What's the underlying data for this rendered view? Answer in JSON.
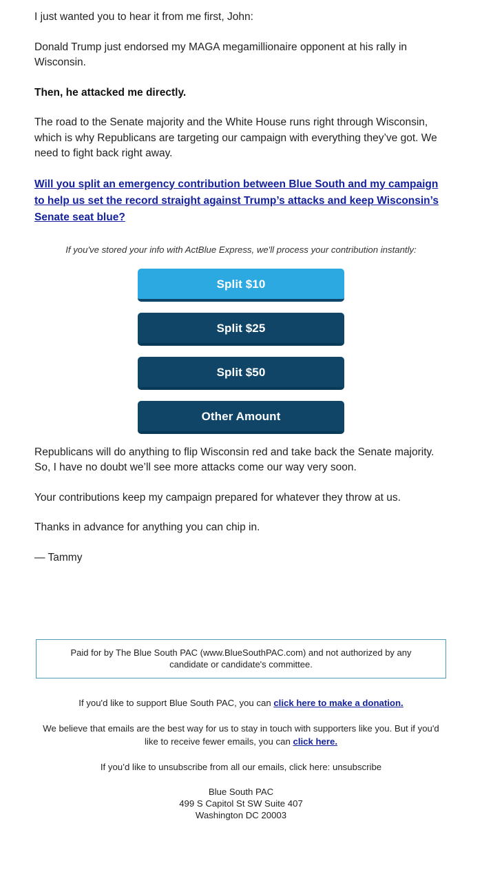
{
  "email": {
    "greeting": "I just wanted you to hear it from me first, John:",
    "paragraph_trump": "Donald Trump just endorsed my MAGA megamillionaire opponent at his rally in Wisconsin.",
    "bold_attack_line": "Then, he attacked me directly.",
    "paragraph_road": "The road to the Senate majority and the White House runs right through Wisconsin, which is why Republicans are targeting our campaign with everything they’ve got. We need to fight back right away.",
    "ask_link": "Will you split an emergency contribution between Blue South and my campaign to help us set the record straight against Trump’s attacks and keep Wisconsin’s Senate seat blue?",
    "express_note": "If you've stored your info with ActBlue Express, we'll process your contribution instantly:",
    "paragraph_republicans": "Republicans will do anything to flip Wisconsin red and take back the Senate majority. So, I have no doubt we’ll see more attacks come our way very soon.",
    "paragraph_contributions": "Your contributions keep my campaign prepared for whatever they throw at us.",
    "paragraph_thanks": "Thanks in advance for anything you can chip in.",
    "signature": "— Tammy"
  },
  "donation_buttons": [
    {
      "label": "Split $10",
      "style": "light"
    },
    {
      "label": "Split $25",
      "style": "dark"
    },
    {
      "label": "Split $50",
      "style": "dark"
    },
    {
      "label": "Other Amount",
      "style": "dark"
    }
  ],
  "disclaimer": {
    "line1": "Paid for by The Blue South PAC (www.BlueSouthPAC.com) and not authorized by any",
    "line2": "candidate or candidate's committee."
  },
  "footer": {
    "support_text_before": "If you'd like to support Blue South PAC, you can ",
    "support_link": "click here to make a donation.",
    "fewer_emails_before": "We believe that emails are the best way for us to stay in touch with supporters like you. But if you'd like to receive fewer emails, you can ",
    "fewer_emails_link": "click here.",
    "unsubscribe_text": "If you’d like to unsubscribe from all our emails, click here: unsubscribe",
    "org_name": "Blue South PAC",
    "address_street": "499 S Capitol St SW Suite 407",
    "address_city": "Washington DC 20003"
  },
  "colors": {
    "link_blue": "#15229b",
    "button_light_blue": "#2ca9e0",
    "button_dark_navy": "#104568",
    "disclaimer_border": "#4e9cb9",
    "body_text": "#222222"
  }
}
